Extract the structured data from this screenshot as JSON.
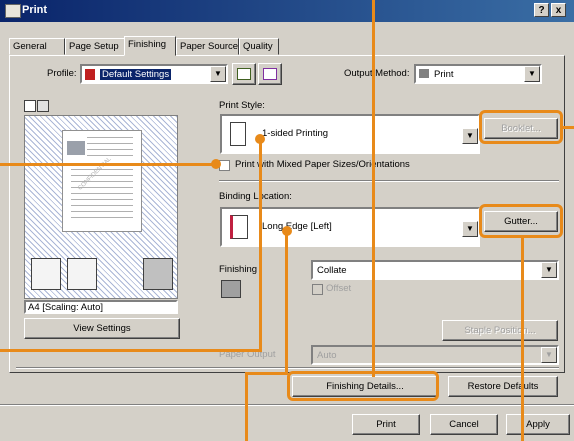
{
  "window": {
    "title": "Print",
    "help_label": "?",
    "close_label": "x"
  },
  "tabs": [
    {
      "label": "General"
    },
    {
      "label": "Page Setup"
    },
    {
      "label": "Finishing"
    },
    {
      "label": "Paper Source"
    },
    {
      "label": "Quality"
    }
  ],
  "profile": {
    "label": "Profile:",
    "value": "Default Settings"
  },
  "output_method": {
    "label": "Output Method:",
    "value": "Print"
  },
  "preview": {
    "scaling_text": "A4 [Scaling: Auto]",
    "view_settings_label": "View Settings",
    "watermark_text": "CONFIDENTIAL"
  },
  "print_style": {
    "label": "Print Style:",
    "value": "1-sided Printing",
    "booklet_label": "Booklet...",
    "mixed_sizes_label": "Print with Mixed Paper Sizes/Orientations"
  },
  "binding": {
    "label": "Binding Location:",
    "value": "Long Edge [Left]",
    "gutter_label": "Gutter..."
  },
  "finishing": {
    "label": "Finishing",
    "value": "Collate",
    "offset_label": "Offset",
    "staple_label": "Staple Position..."
  },
  "paper_output": {
    "label": "Paper Output",
    "value": "Auto"
  },
  "actions": {
    "finishing_details": "Finishing Details...",
    "restore_defaults": "Restore Defaults"
  },
  "dialog_buttons": {
    "print": "Print",
    "cancel": "Cancel",
    "apply": "Apply"
  },
  "colors": {
    "accent_orange": "#e88a1a",
    "title_blue": "#0a246a",
    "face": "#d4d0c8"
  }
}
